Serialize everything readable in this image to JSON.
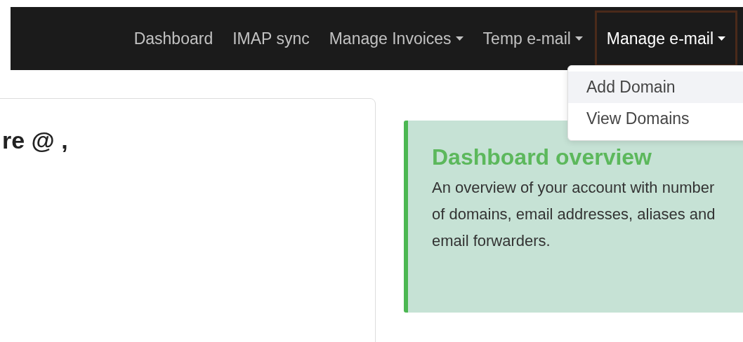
{
  "navbar": {
    "items": [
      {
        "label": "Dashboard",
        "kind": "link",
        "selected": false
      },
      {
        "label": "IMAP sync",
        "kind": "link",
        "selected": false
      },
      {
        "label": "Manage Invoices",
        "kind": "dropdown",
        "selected": false
      },
      {
        "label": "Temp e-mail",
        "kind": "dropdown",
        "selected": false
      },
      {
        "label": "Manage e-mail",
        "kind": "dropdown",
        "selected": true
      }
    ]
  },
  "dropdown_menu": {
    "items": [
      {
        "label": "Add Domain",
        "selected": true
      },
      {
        "label": "View Domains",
        "selected": false
      }
    ]
  },
  "welcome_card": {
    "heading": "re @ ,"
  },
  "overview_callout": {
    "title": "Dashboard overview",
    "text": "An overview of your account with number of domains, email addresses, aliases and email forwarders."
  }
}
